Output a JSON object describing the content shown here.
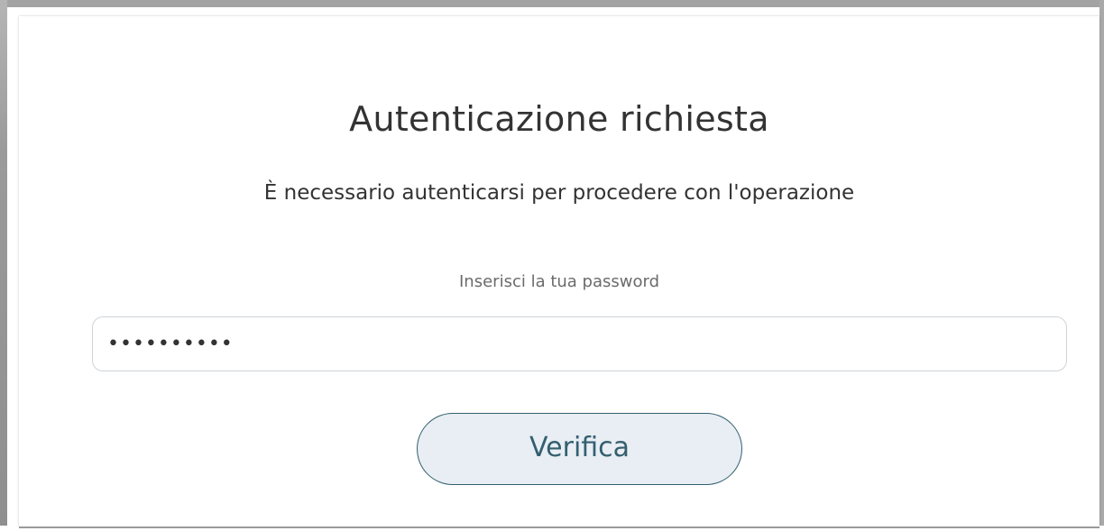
{
  "dialog": {
    "title": "Autenticazione richiesta",
    "subtitle": "È necessario autenticarsi per procedere con l'operazione",
    "password_label": "Inserisci la tua password",
    "password_value": "••••••••••",
    "verify_button_label": "Verifica"
  },
  "colors": {
    "button_border": "#345f70",
    "button_background": "#e8eef3",
    "text_primary": "#333333",
    "label_muted": "#6b6b6b"
  }
}
